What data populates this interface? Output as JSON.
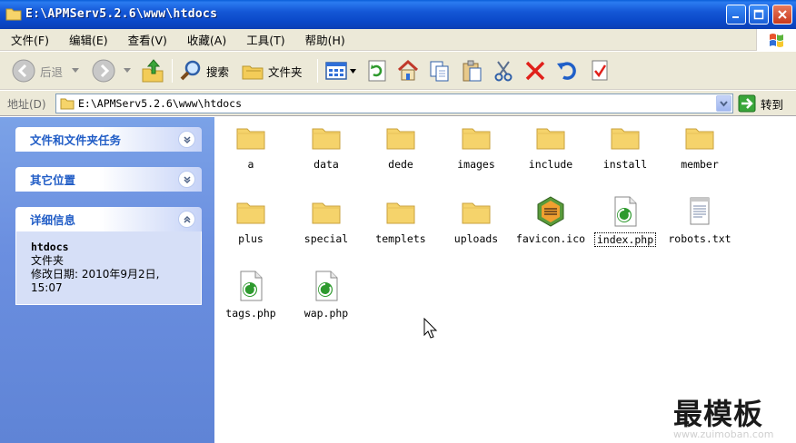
{
  "window": {
    "title": "E:\\APMServ5.2.6\\www\\htdocs"
  },
  "menu": [
    "文件(F)",
    "编辑(E)",
    "查看(V)",
    "收藏(A)",
    "工具(T)",
    "帮助(H)"
  ],
  "toolbar": {
    "back_label": "后退",
    "search_label": "搜索",
    "folders_label": "文件夹"
  },
  "address": {
    "label": "地址(D)",
    "value": "E:\\APMServ5.2.6\\www\\htdocs",
    "go_label": "转到"
  },
  "taskpane": {
    "tasks_title": "文件和文件夹任务",
    "other_title": "其它位置",
    "details_title": "详细信息",
    "details_name": "htdocs",
    "details_type": "文件夹",
    "details_modified": "修改日期: 2010年9月2日, 15:07"
  },
  "files": [
    {
      "name": "a",
      "type": "folder"
    },
    {
      "name": "data",
      "type": "folder"
    },
    {
      "name": "dede",
      "type": "folder"
    },
    {
      "name": "images",
      "type": "folder"
    },
    {
      "name": "include",
      "type": "folder"
    },
    {
      "name": "install",
      "type": "folder"
    },
    {
      "name": "member",
      "type": "folder"
    },
    {
      "name": "plus",
      "type": "folder"
    },
    {
      "name": "special",
      "type": "folder"
    },
    {
      "name": "templets",
      "type": "folder"
    },
    {
      "name": "uploads",
      "type": "folder"
    },
    {
      "name": "favicon.ico",
      "type": "ico"
    },
    {
      "name": "index.php",
      "type": "php"
    },
    {
      "name": "robots.txt",
      "type": "txt"
    },
    {
      "name": "tags.php",
      "type": "php"
    },
    {
      "name": "wap.php",
      "type": "php"
    }
  ],
  "watermark": {
    "text": "最模板",
    "url": "www.zuimoban.com"
  },
  "colors": {
    "titlebar": "#0a48c8",
    "taskpane": "#6b8fe0",
    "panel_title": "#215dc6",
    "folder": "#f5d36b"
  }
}
